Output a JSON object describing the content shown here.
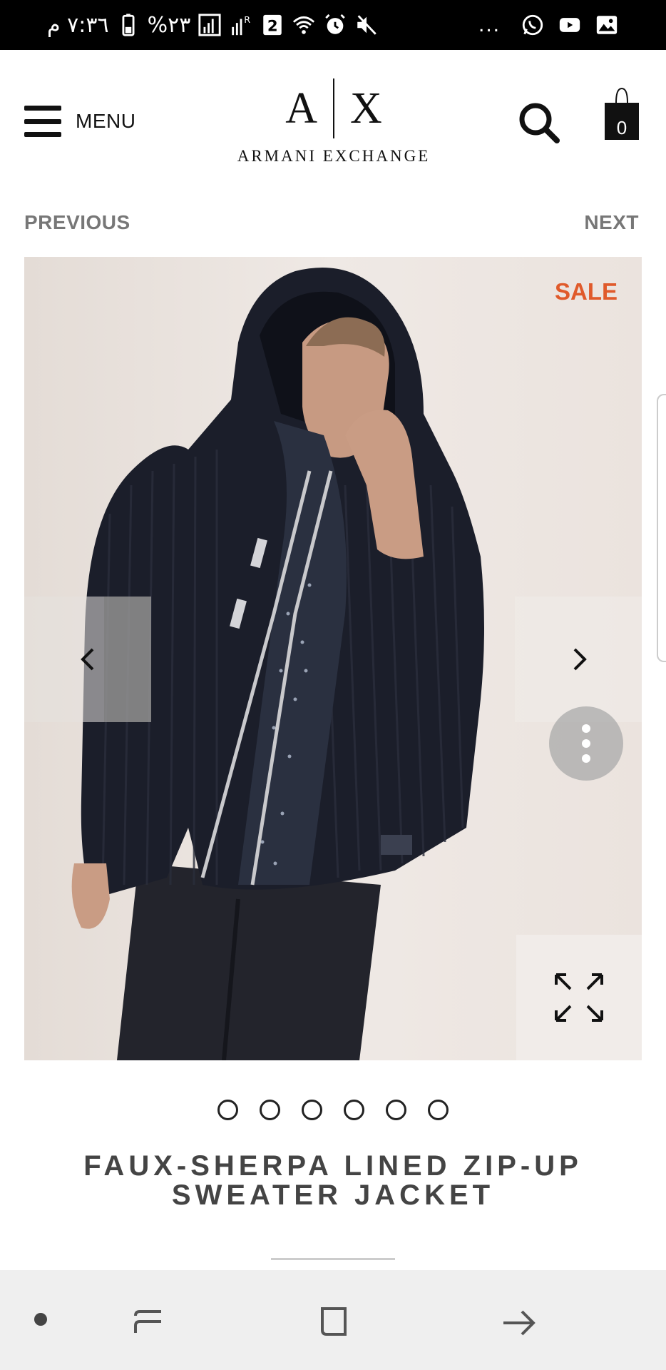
{
  "status_bar": {
    "time": "٧:٣٦ م",
    "battery": "%٢٣",
    "sim_badge": "2",
    "signal_label": "R",
    "notifications": "..."
  },
  "header": {
    "menu_label": "MENU",
    "logo_left": "A",
    "logo_right": "X",
    "logo_name": "ARMANI EXCHANGE",
    "cart_count": "0"
  },
  "pager": {
    "previous": "PREVIOUS",
    "next": "NEXT"
  },
  "gallery": {
    "badge": "SALE",
    "image_count": 6,
    "active_index": 0
  },
  "product": {
    "title": "FAUX-SHERPA LINED ZIP-UP SWEATER JACKET"
  },
  "colors": {
    "sale": "#e05a2b",
    "title": "#444444",
    "status_bar": "#000000",
    "nav_bar": "#efefef"
  },
  "icons": [
    "hamburger-icon",
    "search-icon",
    "bag-icon",
    "chevron-left-icon",
    "chevron-right-icon",
    "more-vertical-icon",
    "expand-icon",
    "recents-icon",
    "home-icon",
    "back-icon"
  ]
}
